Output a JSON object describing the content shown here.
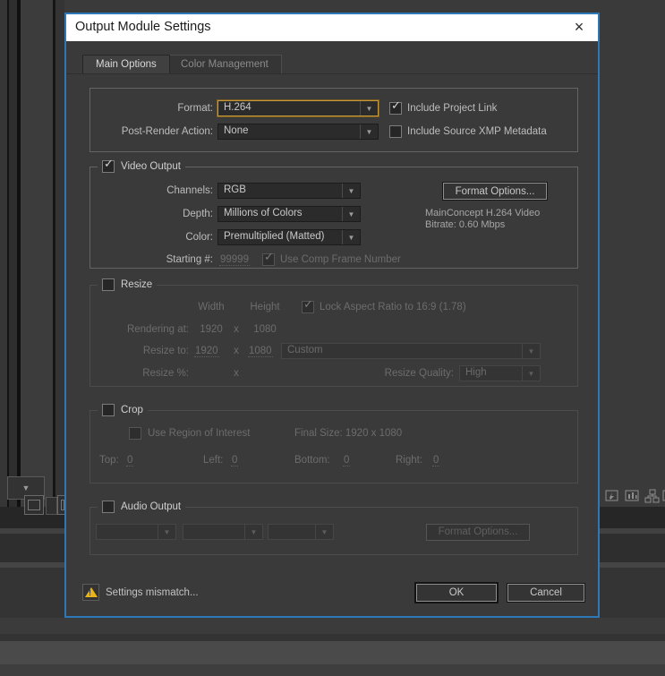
{
  "window": {
    "title": "Output Module Settings",
    "close_icon": "×"
  },
  "tabs": {
    "main": "Main Options",
    "color": "Color Management"
  },
  "icons": {
    "dropdown_arrow": "▼",
    "check": "✓",
    "warning_mark": "!"
  },
  "format_section": {
    "format_label": "Format:",
    "format_value": "H.264",
    "include_project_link": "Include Project Link",
    "post_render_label": "Post-Render Action:",
    "post_render_value": "None",
    "include_xmp": "Include Source XMP Metadata"
  },
  "video": {
    "title": "Video Output",
    "channels_label": "Channels:",
    "channels_value": "RGB",
    "depth_label": "Depth:",
    "depth_value": "Millions of Colors",
    "color_label": "Color:",
    "color_value": "Premultiplied (Matted)",
    "starting_label": "Starting #:",
    "starting_value": "99999",
    "use_comp_frame": "Use Comp Frame Number",
    "format_options_button": "Format Options...",
    "codec_line1": "MainConcept H.264 Video",
    "codec_line2": "Bitrate: 0.60 Mbps"
  },
  "resize": {
    "title": "Resize",
    "width_header": "Width",
    "height_header": "Height",
    "lock_aspect": "Lock Aspect Ratio to 16:9 (1.78)",
    "rendering_label": "Rendering at:",
    "rendering_width": "1920",
    "rendering_height": "1080",
    "resize_to_label": "Resize to:",
    "resize_width": "1920",
    "resize_height": "1080",
    "separator": "x",
    "preset_value": "Custom",
    "percent_label": "Resize %:",
    "quality_label": "Resize Quality:",
    "quality_value": "High"
  },
  "crop": {
    "title": "Crop",
    "use_roi": "Use Region of Interest",
    "final_size": "Final Size: 1920 x 1080",
    "top_label": "Top:",
    "top_value": "0",
    "left_label": "Left:",
    "left_value": "0",
    "bottom_label": "Bottom:",
    "bottom_value": "0",
    "right_label": "Right:",
    "right_value": "0"
  },
  "audio": {
    "title": "Audio Output",
    "format_options_button": "Format Options..."
  },
  "footer": {
    "warning_text": "Settings mismatch...",
    "ok_label": "OK",
    "cancel_label": "Cancel"
  },
  "colors": {
    "dialog_border": "#2e78b8",
    "focus_ring": "#c79b3b",
    "warning_yellow": "#e9b51a",
    "title_bar_bg": "#ffffff"
  }
}
